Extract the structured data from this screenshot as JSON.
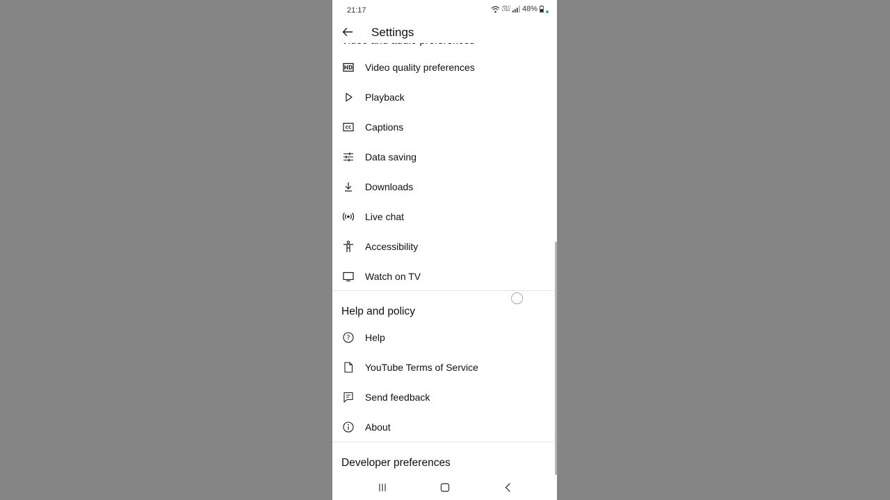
{
  "status_bar": {
    "time": "21:17",
    "network": "VoLTE LTE2",
    "battery": "48%"
  },
  "app_bar": {
    "title": "Settings"
  },
  "cutoff_heading": "Video and audio preferences",
  "video_audio_items": [
    {
      "label": "Video quality preferences",
      "icon": "hd-icon"
    },
    {
      "label": "Playback",
      "icon": "play-icon"
    },
    {
      "label": "Captions",
      "icon": "captions-icon"
    },
    {
      "label": "Data saving",
      "icon": "sliders-icon"
    },
    {
      "label": "Downloads",
      "icon": "download-icon"
    },
    {
      "label": "Live chat",
      "icon": "live-icon"
    },
    {
      "label": "Accessibility",
      "icon": "accessibility-icon"
    },
    {
      "label": "Watch on TV",
      "icon": "tv-icon"
    }
  ],
  "help_section": {
    "title": "Help and policy",
    "items": [
      {
        "label": "Help",
        "icon": "help-icon"
      },
      {
        "label": "YouTube Terms of Service",
        "icon": "document-icon"
      },
      {
        "label": "Send feedback",
        "icon": "feedback-icon"
      },
      {
        "label": "About",
        "icon": "info-icon"
      }
    ]
  },
  "developer_section": {
    "title": "Developer preferences"
  },
  "nav_bar": {
    "recents": "recents-icon",
    "home": "home-icon",
    "back": "back-icon"
  },
  "colors": {
    "background": "#858585",
    "surface": "#ffffff",
    "text": "#0f0f0f",
    "divider": "#e6e6e6"
  }
}
